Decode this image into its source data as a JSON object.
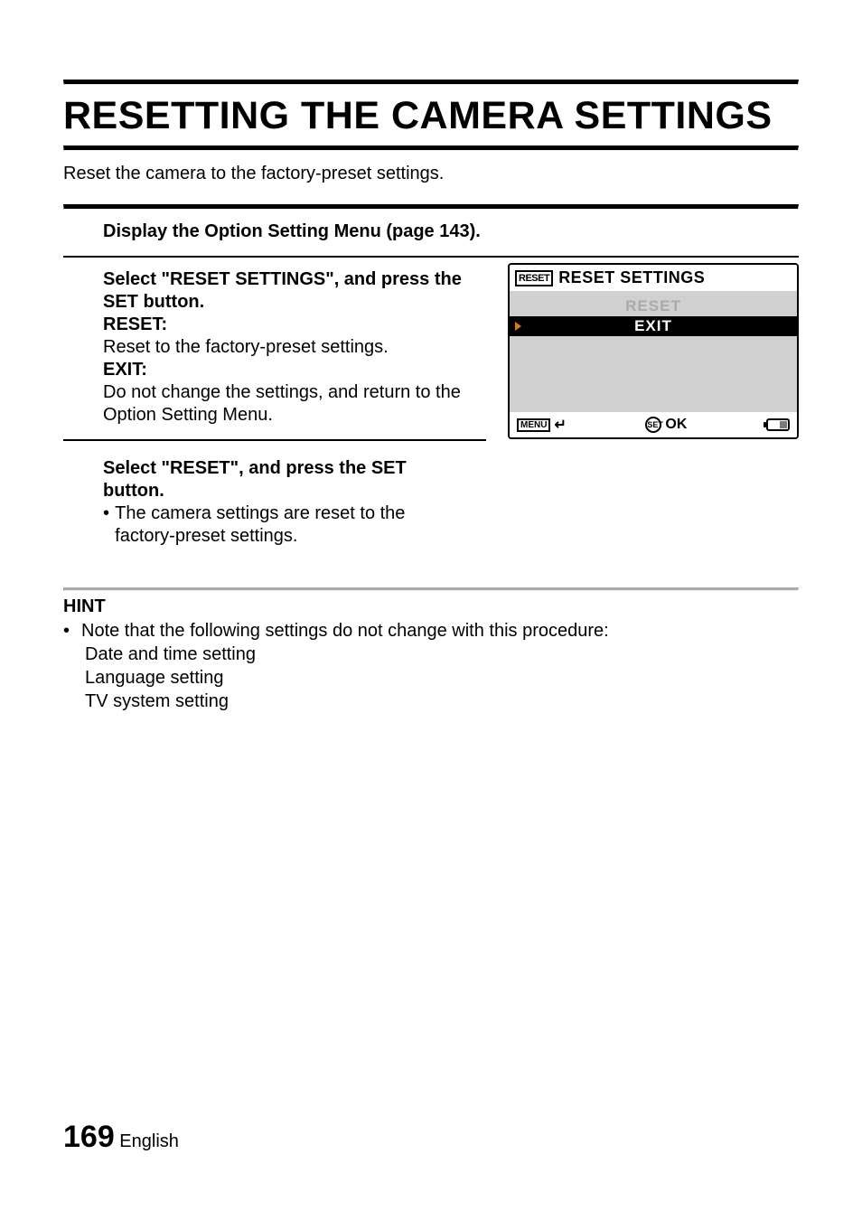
{
  "title": "RESETTING THE CAMERA SETTINGS",
  "intro": "Reset the camera to the factory-preset settings.",
  "step1": {
    "text": "Display the Option Setting Menu (page 143)."
  },
  "step2": {
    "line1": "Select \"RESET SETTINGS\", and press the SET button.",
    "reset_label": "RESET:",
    "reset_desc": "Reset to the factory-preset settings.",
    "exit_label": "EXIT:",
    "exit_desc": "Do not change the settings, and return to the Option Setting Menu."
  },
  "step3": {
    "line1": "Select \"RESET\", and press the SET button.",
    "bullet": "The camera settings are reset to the factory-preset settings."
  },
  "osd": {
    "badge": "RESET",
    "title": "RESET SETTINGS",
    "items": [
      "RESET",
      "EXIT"
    ],
    "selected_index": 1,
    "footer_menu": "MENU",
    "footer_set": "SET",
    "footer_ok": "OK"
  },
  "hint": {
    "title": "HINT",
    "lead": "Note that the following settings do not change with this procedure:",
    "items": [
      "Date and time setting",
      "Language setting",
      "TV system setting"
    ]
  },
  "footer": {
    "page_number": "169",
    "language": "English"
  }
}
